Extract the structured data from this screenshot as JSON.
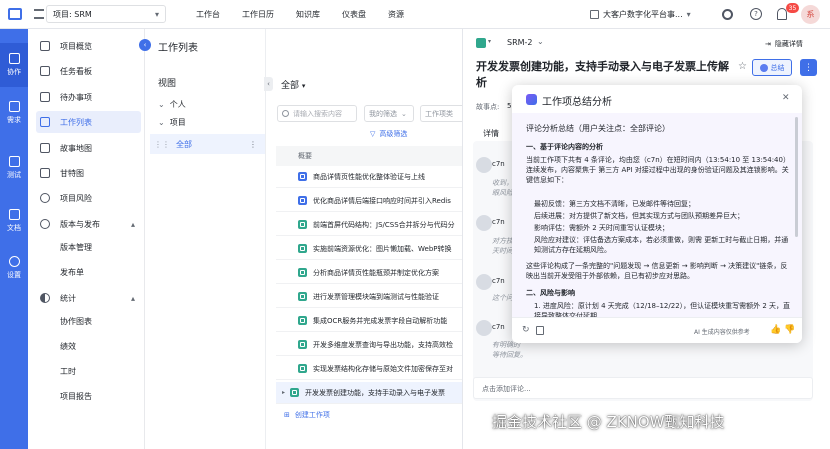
{
  "topbar": {
    "project_selector": "项目: SRM",
    "nav": [
      "工作台",
      "工作日历",
      "知识库",
      "仪表盘",
      "资源"
    ],
    "org_selector": "大客户数字化平台事...",
    "notification_count": "35",
    "avatar_text": "系"
  },
  "rail": {
    "items": [
      {
        "label": "协作"
      },
      {
        "label": "需求"
      },
      {
        "label": "测试"
      },
      {
        "label": "文档"
      },
      {
        "label": "设置"
      }
    ]
  },
  "sidebar": {
    "items": [
      {
        "label": "项目概览"
      },
      {
        "label": "任务看板"
      },
      {
        "label": "待办事项"
      },
      {
        "label": "工作列表"
      },
      {
        "label": "故事地图"
      },
      {
        "label": "甘特图"
      },
      {
        "label": "项目风险"
      },
      {
        "label": "版本与发布"
      }
    ],
    "version_sub": [
      "版本管理",
      "发布单"
    ],
    "stats_label": "统计",
    "stats_sub": [
      "协作图表",
      "绩效",
      "工时",
      "项目报告"
    ]
  },
  "views": {
    "page_title": "工作列表",
    "header": "视图",
    "groups": [
      {
        "label": "个人"
      },
      {
        "label": "项目"
      }
    ],
    "selected": "全部"
  },
  "list": {
    "title": "全部",
    "search_placeholder": "请输入搜索内容",
    "filter1": "我的筛选",
    "filter2": "工作项类",
    "advanced_filter": "高级筛选",
    "column_header": "概要",
    "rows": [
      {
        "title": "商品详情页性能优化整体验证与上线",
        "type": "blue"
      },
      {
        "title": "优化商品详情后端接口响应时间并引入Redis",
        "type": "blue"
      },
      {
        "title": "前端首屏代码结构：JS/CSS合并拆分与代码分",
        "type": "green"
      },
      {
        "title": "实施前端资源优化：图片懒加载、WebP转换",
        "type": "green"
      },
      {
        "title": "分析商品详情页性能瓶颈并制定优化方案",
        "type": "green"
      },
      {
        "title": "进行发票管理模块端到端测试与性能验证",
        "type": "green"
      },
      {
        "title": "集成OCR服务并完成发票字段自动解析功能",
        "type": "green"
      },
      {
        "title": "开发多维度发票查询与导出功能，支持高效检",
        "type": "green"
      },
      {
        "title": "实现发票结构化存储与原始文件加密保存至对",
        "type": "green"
      },
      {
        "title": "开发发票创建功能，支持手动录入与电子发票",
        "type": "green"
      }
    ],
    "create_label": "创建工作项"
  },
  "detail": {
    "item_id": "SRM-2",
    "hide_details": "隐藏详情",
    "title": "开发发票创建功能，支持手动录入与电子发票上传解析",
    "summary_button": "总结",
    "point_label": "故事点:",
    "point_value": "5",
    "tab_label": "详情",
    "comments": [
      {
        "author": "c7n",
        "lines": [
          "收到，",
          "眼风险"
        ]
      },
      {
        "author": "c7n",
        "lines": [
          "对方技",
          "天时间"
        ]
      },
      {
        "author": "c7n",
        "lines": [
          "这个问"
        ]
      },
      {
        "author": "c7n",
        "lines": [
          "有明确的",
          "等待回复。"
        ]
      }
    ],
    "add_comment": "点击添加评论..."
  },
  "popup": {
    "title": "工作项总结分析",
    "subtitle": "评论分析总结（用户关注点：全部评论）",
    "section1": "一、基于评论内容的分析",
    "para1": "当前工作项下共有 4 条评论，均由您（c7n）在短时间内（13:54:10 至 13:54:40）连续发布，内容聚焦于 第三方 API 对接过程中出现的身份验证问题及其连锁影响。关键信息如下：",
    "bullets": [
      "最初反馈：第三方文档不清晰，已发邮件等待回复；",
      "后续进展：对方提供了新文档，但其实现方式与团队预期差异巨大；",
      "影响评估：需额外 2 天时间重写认证模块；",
      "风险应对建议：评估备选方案成本，若必须重做，则需 更新工时与截止日期，并通知测试方存在延期风险。"
    ],
    "para2": "这些评论构成了一条完整的\"问题发现 → 信息更新 → 影响判断 → 决策建议\"链条，反映出当前开发受阻于外部依赖，且已有初步应对思路。",
    "section2": "二、风险与影响",
    "risk1": "1. 进度风险：原计划 4 天完成（12/18–12/22），但认证模块重写需额外 2 天，直接导致整体交付延期",
    "disclaimer": "AI 生成内容仅供参考"
  },
  "watermark": "掘金技术社区 @ ZKNOW甄知科技"
}
